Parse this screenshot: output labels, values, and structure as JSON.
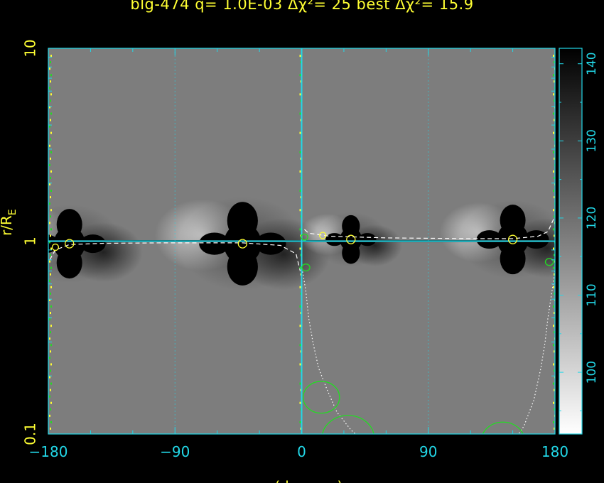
{
  "title": "blg-474 q= 1.0E-03 Δχ²= 25 best Δχ²= 15.9",
  "colors": {
    "axis": "#22d8e8",
    "label": "#ffff33",
    "caustic_green": "#22dd22",
    "trajectory": "#ffffff",
    "background_gray": "#7d7d7d"
  },
  "chart_data": {
    "type": "heatmap",
    "title": "blg-474 q= 1.0E-03 Δχ²= 25 best Δχ²= 15.9",
    "xlabel": "α (degrees)",
    "ylabel": "r/R_E",
    "ylabel_main": "r/R",
    "ylabel_sub": "E",
    "xlim": [
      -180,
      180
    ],
    "ylim": [
      0.1,
      10
    ],
    "yscale": "log",
    "x_ticks": [
      -180,
      -90,
      0,
      90,
      180
    ],
    "x_tick_labels": [
      "−180",
      "−90",
      "0",
      "90",
      "180"
    ],
    "y_ticks": [
      0.1,
      1,
      10
    ],
    "y_tick_labels": [
      "0.1",
      "1",
      "10"
    ],
    "colorbar": {
      "range": [
        92,
        142
      ],
      "ticks": [
        100,
        110,
        120,
        130,
        140
      ],
      "tick_labels": [
        "100",
        "110",
        "120",
        "130",
        "140"
      ],
      "low_color": "white",
      "high_color": "black"
    },
    "grid": true,
    "reference_lines": {
      "x": 0,
      "y": 1
    },
    "lobe_groups": [
      {
        "alpha": -165,
        "r": 0.97,
        "size": 1.0
      },
      {
        "alpha": -42,
        "r": 0.97,
        "size": 1.2
      },
      {
        "alpha": 35,
        "r": 1.02,
        "size": 0.7
      },
      {
        "alpha": 150,
        "r": 1.02,
        "size": 1.0
      }
    ],
    "yellow_circles": [
      {
        "alpha": -165,
        "r": 0.97
      },
      {
        "alpha": -42,
        "r": 0.97
      },
      {
        "alpha": 35,
        "r": 1.02
      },
      {
        "alpha": 150,
        "r": 1.02
      },
      {
        "alpha": -175,
        "r": 0.93
      },
      {
        "alpha": 15,
        "r": 1.07
      }
    ],
    "green_circles": [
      {
        "alpha": 14,
        "r": 0.155,
        "size": 1.6
      },
      {
        "alpha": 33,
        "r": 0.095,
        "size": 2.3
      },
      {
        "alpha": 143,
        "r": 0.092,
        "size": 1.9
      },
      {
        "alpha": 3,
        "r": 0.73,
        "size": 0.35
      },
      {
        "alpha": 176,
        "r": 0.78,
        "size": 0.35
      },
      {
        "alpha": 2,
        "r": 1.05,
        "size": 0.3
      }
    ],
    "dashed_trajectory": [
      [
        -179,
        0.8
      ],
      [
        -175,
        0.9
      ],
      [
        -165,
        0.96
      ],
      [
        -140,
        0.975
      ],
      [
        -100,
        0.98
      ],
      [
        -42,
        0.98
      ],
      [
        -15,
        0.95
      ],
      [
        -4,
        0.86
      ],
      [
        -1,
        0.7
      ]
    ],
    "dashed_trajectory_2": [
      [
        2,
        1.15
      ],
      [
        5,
        1.1
      ],
      [
        20,
        1.06
      ],
      [
        60,
        1.04
      ],
      [
        120,
        1.03
      ],
      [
        150,
        1.03
      ],
      [
        168,
        1.06
      ],
      [
        175,
        1.12
      ],
      [
        179,
        1.3
      ]
    ],
    "dotted_curves": [
      [
        [
          0,
          0.75
        ],
        [
          3,
          0.55
        ],
        [
          5,
          0.4
        ],
        [
          8,
          0.3
        ],
        [
          12,
          0.22
        ],
        [
          18,
          0.17
        ],
        [
          25,
          0.13
        ],
        [
          35,
          0.105
        ],
        [
          45,
          0.09
        ]
      ],
      [
        [
          180,
          0.7
        ],
        [
          177,
          0.5
        ],
        [
          175,
          0.4
        ],
        [
          173,
          0.3
        ],
        [
          170,
          0.22
        ],
        [
          165,
          0.15
        ],
        [
          158,
          0.11
        ],
        [
          150,
          0.09
        ]
      ]
    ]
  }
}
